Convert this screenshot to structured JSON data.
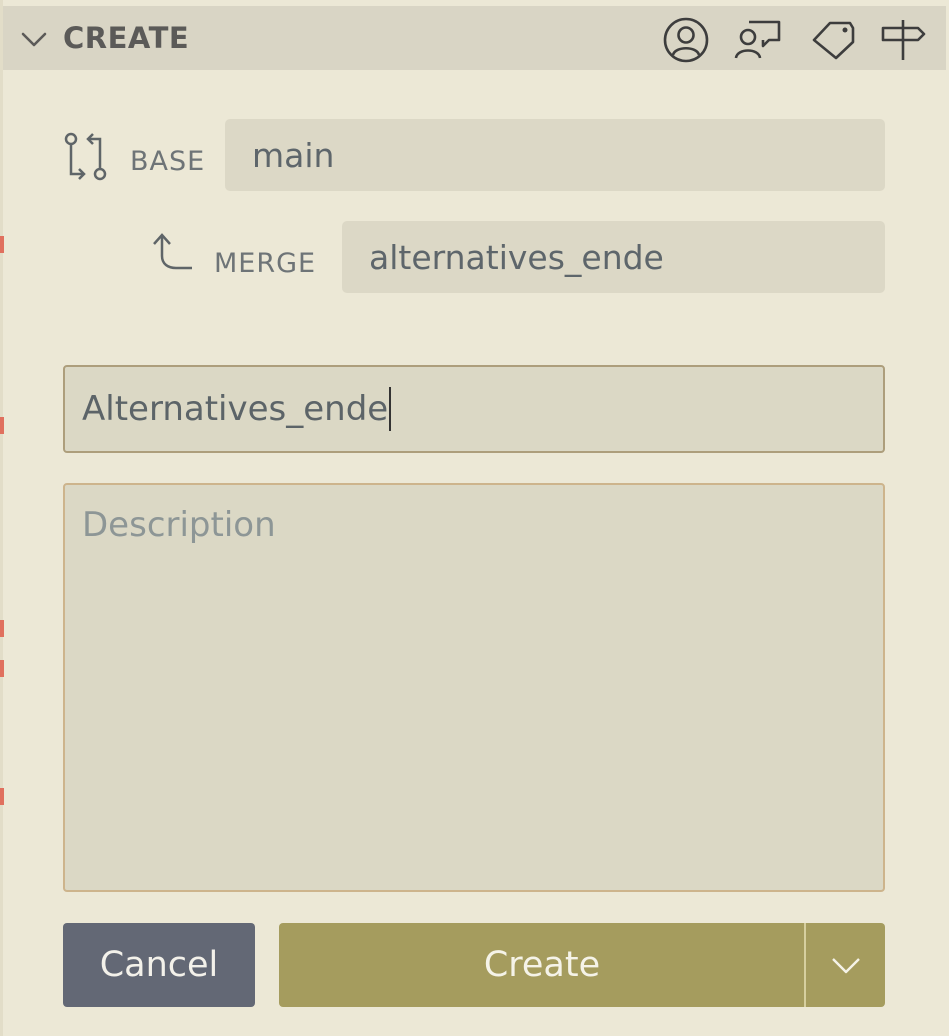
{
  "header": {
    "title": "CREATE",
    "icons": [
      "chevron-down-icon",
      "account-icon",
      "reviewers-icon",
      "tag-icon",
      "milestone-icon"
    ]
  },
  "base": {
    "label": "BASE",
    "value": "main"
  },
  "merge": {
    "label": "MERGE",
    "value": "alternatives_ende"
  },
  "title_input": {
    "value": "Alternatives_ende"
  },
  "description": {
    "placeholder": "Description",
    "value": ""
  },
  "buttons": {
    "cancel": "Cancel",
    "create": "Create"
  },
  "colors": {
    "background": "#ece8d6",
    "header": "#d9d5c5",
    "field": "#dcd8c6",
    "create_button": "#a59c5e",
    "cancel_button": "#636875",
    "edge_marker": "#e0705e"
  }
}
